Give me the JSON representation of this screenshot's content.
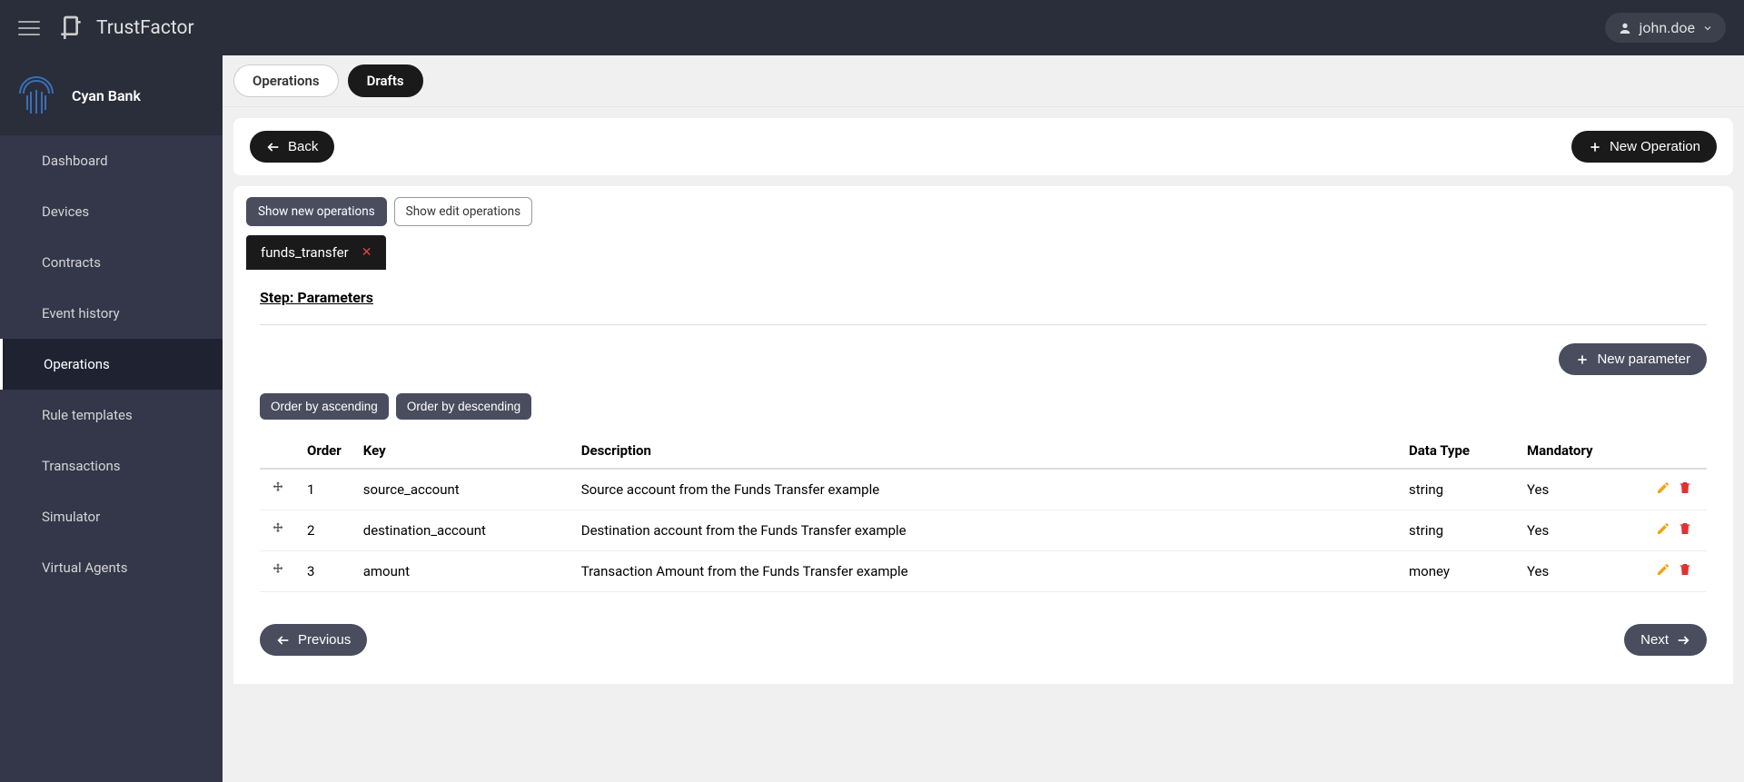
{
  "header": {
    "app_name": "TrustFactor",
    "user": "john.doe"
  },
  "sidebar": {
    "org_name": "Cyan Bank",
    "items": [
      {
        "label": "Dashboard"
      },
      {
        "label": "Devices"
      },
      {
        "label": "Contracts"
      },
      {
        "label": "Event history"
      },
      {
        "label": "Operations"
      },
      {
        "label": "Rule templates"
      },
      {
        "label": "Transactions"
      },
      {
        "label": "Simulator"
      },
      {
        "label": "Virtual Agents"
      }
    ],
    "active_index": 4
  },
  "pills": {
    "operations": "Operations",
    "drafts": "Drafts"
  },
  "topcard": {
    "back": "Back",
    "new_operation": "New Operation"
  },
  "filters": {
    "show_new": "Show new operations",
    "show_edit": "Show edit operations"
  },
  "op_tab": {
    "name": "funds_transfer"
  },
  "panel": {
    "step_title": "Step: Parameters",
    "new_parameter": "New parameter",
    "order_asc": "Order by ascending",
    "order_desc": "Order by descending",
    "columns": {
      "order": "Order",
      "key": "Key",
      "description": "Description",
      "data_type": "Data Type",
      "mandatory": "Mandatory"
    },
    "rows": [
      {
        "order": "1",
        "key": "source_account",
        "description": "Source account from the Funds Transfer example",
        "data_type": "string",
        "mandatory": "Yes"
      },
      {
        "order": "2",
        "key": "destination_account",
        "description": "Destination account from the Funds Transfer example",
        "data_type": "string",
        "mandatory": "Yes"
      },
      {
        "order": "3",
        "key": "amount",
        "description": "Transaction Amount from the Funds Transfer example",
        "data_type": "money",
        "mandatory": "Yes"
      }
    ],
    "previous": "Previous",
    "next": "Next"
  }
}
